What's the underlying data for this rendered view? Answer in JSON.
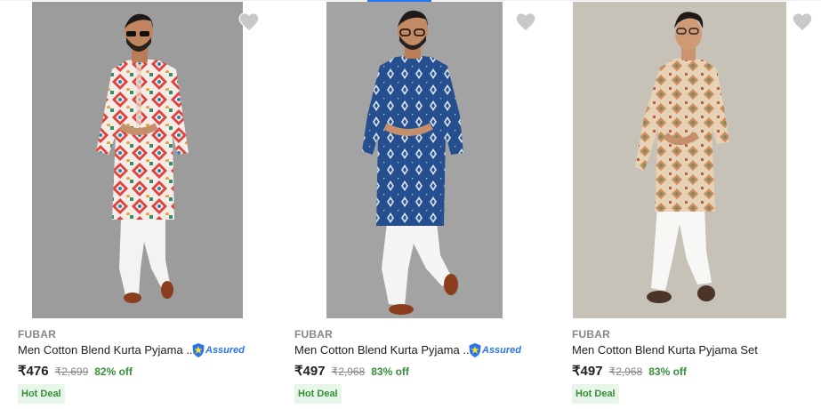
{
  "colors": {
    "accent": "#2874f0",
    "discount": "#388e3c",
    "deal_bg": "#e8f5e9",
    "muted": "#878787"
  },
  "products": [
    {
      "brand": "FUBAR",
      "title": "Men Cotton Blend Kurta Pyjama ...",
      "assured": true,
      "assured_label": "Assured",
      "price": "₹476",
      "mrp": "₹2,699",
      "discount": "82% off",
      "badge": "Hot Deal",
      "wishlist_icon": "heart-icon",
      "kurta_color": "multicolor-pink"
    },
    {
      "brand": "FUBAR",
      "title": "Men Cotton Blend Kurta Pyjama ...",
      "assured": true,
      "assured_label": "Assured",
      "price": "₹497",
      "mrp": "₹2,968",
      "discount": "83% off",
      "badge": "Hot Deal",
      "wishlist_icon": "heart-icon",
      "kurta_color": "blue"
    },
    {
      "brand": "FUBAR",
      "title": "Men Cotton Blend Kurta Pyjama Set",
      "assured": false,
      "price": "₹497",
      "mrp": "₹2,968",
      "discount": "83% off",
      "badge": "Hot Deal",
      "wishlist_icon": "heart-icon",
      "kurta_color": "beige-multicolor"
    }
  ]
}
